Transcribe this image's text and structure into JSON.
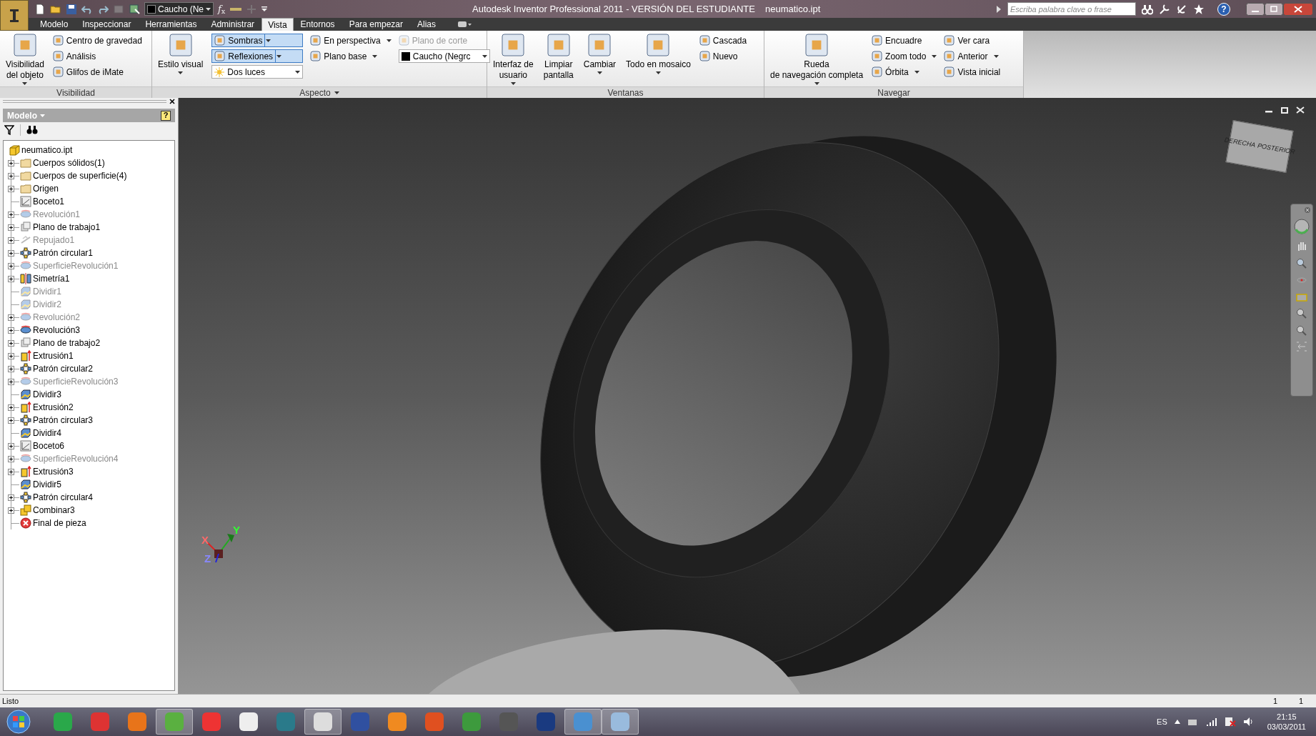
{
  "title_bar": {
    "style_dropdown": "Caucho (Ne",
    "function_button": "*f*$_{x}$",
    "help_button": "?",
    "title": "Autodesk Inventor Professional 2011 - VERSIÓN DEL ESTUDIANTE",
    "document": "neumatico.ipt",
    "search": {
      "placeholder": "Escriba palabra clave o frase"
    }
  },
  "tabs": [
    {
      "label": "Modelo",
      "selected": false
    },
    {
      "label": "Inspeccionar",
      "selected": false
    },
    {
      "label": "Herramientas",
      "selected": false
    },
    {
      "label": "Administrar",
      "selected": false
    },
    {
      "label": "Vista",
      "selected": true
    },
    {
      "label": "Entornos",
      "selected": false
    },
    {
      "label": "Para empezar",
      "selected": false
    },
    {
      "label": "Alias",
      "selected": false
    }
  ],
  "ribbon": [
    {
      "title": "Visibilidad",
      "menu": false,
      "groups": [
        {
          "kind": "large",
          "lines": [
            "Visibilidad",
            "del objeto"
          ],
          "dropdown": true
        },
        {
          "kind": "column",
          "items": [
            {
              "kind": "button",
              "label": "Centro de gravedad",
              "dropdown": false,
              "disabled": false
            },
            {
              "kind": "button",
              "label": "Análisis",
              "dropdown": false,
              "disabled": false
            },
            {
              "kind": "button",
              "label": "Glifos de iMate",
              "dropdown": false,
              "disabled": false
            }
          ]
        }
      ]
    },
    {
      "title": "Aspecto",
      "menu": true,
      "groups": [
        {
          "kind": "large",
          "lines": [
            "Estilo visual"
          ],
          "dropdown": true
        },
        {
          "kind": "column",
          "items": [
            {
              "kind": "toggle",
              "label": "Sombras",
              "on": true
            },
            {
              "kind": "toggle",
              "label": "Reflexiones",
              "on": true
            },
            {
              "kind": "combo",
              "value": "Dos luces",
              "swatch": false
            }
          ]
        },
        {
          "kind": "column",
          "items": [
            {
              "kind": "button",
              "label": "En perspectiva",
              "dropdown": true,
              "disabled": false
            },
            {
              "kind": "button",
              "label": "Plano base",
              "dropdown": true,
              "disabled": false
            }
          ]
        },
        {
          "kind": "column",
          "items": [
            {
              "kind": "button",
              "label": "Plano de corte",
              "dropdown": false,
              "disabled": true
            },
            {
              "kind": "combo",
              "value": "Caucho (Negrc",
              "swatch": true
            }
          ]
        }
      ]
    },
    {
      "title": "Ventanas",
      "menu": false,
      "groups": [
        {
          "kind": "large",
          "lines": [
            "Interfaz de",
            "usuario"
          ],
          "dropdown": true
        },
        {
          "kind": "large",
          "lines": [
            "Limpiar",
            "pantalla"
          ],
          "dropdown": false
        },
        {
          "kind": "large",
          "lines": [
            "Cambiar"
          ],
          "dropdown": true
        },
        {
          "kind": "large",
          "lines": [
            "Todo en mosaico"
          ],
          "dropdown": true
        },
        {
          "kind": "column",
          "items": [
            {
              "kind": "button",
              "label": "Cascada",
              "dropdown": false,
              "disabled": false
            },
            {
              "kind": "button",
              "label": "Nuevo",
              "dropdown": false,
              "disabled": false
            }
          ]
        }
      ]
    },
    {
      "title": "Navegar",
      "menu": false,
      "groups": [
        {
          "kind": "large",
          "lines": [
            "Rueda",
            "de navegación completa"
          ],
          "dropdown": true
        },
        {
          "kind": "column",
          "items": [
            {
              "kind": "button",
              "label": "Encuadre",
              "dropdown": false,
              "disabled": false
            },
            {
              "kind": "button",
              "label": "Zoom todo",
              "dropdown": true,
              "disabled": false
            },
            {
              "kind": "button",
              "label": "Órbita",
              "dropdown": true,
              "disabled": false
            }
          ]
        },
        {
          "kind": "column",
          "items": [
            {
              "kind": "button",
              "label": "Ver cara",
              "dropdown": false,
              "disabled": false
            },
            {
              "kind": "button",
              "label": "Anterior",
              "dropdown": true,
              "disabled": false
            },
            {
              "kind": "button",
              "label": "Vista inicial",
              "dropdown": false,
              "disabled": false
            }
          ]
        }
      ]
    }
  ],
  "browser": {
    "title": "Modelo",
    "help_button": "?",
    "tree": [
      {
        "label": "neumatico.ipt",
        "kind": "part",
        "expandable": false,
        "dimmed": false,
        "children": [
          {
            "label": "Cuerpos sólidos(1)",
            "kind": "folder",
            "expandable": true,
            "dimmed": false
          },
          {
            "label": "Cuerpos de superficie(4)",
            "kind": "folder",
            "expandable": true,
            "dimmed": false
          },
          {
            "label": "Origen",
            "kind": "folder",
            "expandable": true,
            "dimmed": false
          },
          {
            "label": "Boceto1",
            "kind": "sketch",
            "expandable": false,
            "dimmed": false
          },
          {
            "label": "Revolución1",
            "kind": "revolve",
            "expandable": true,
            "dimmed": true
          },
          {
            "label": "Plano de trabajo1",
            "kind": "plane",
            "expandable": true,
            "dimmed": false
          },
          {
            "label": "Repujado1",
            "kind": "emboss",
            "expandable": true,
            "dimmed": true
          },
          {
            "label": "Patrón circular1",
            "kind": "pattern",
            "expandable": true,
            "dimmed": false
          },
          {
            "label": "SuperficieRevolución1",
            "kind": "revolve",
            "expandable": true,
            "dimmed": true
          },
          {
            "label": "Simetría1",
            "kind": "mirror",
            "expandable": true,
            "dimmed": false
          },
          {
            "label": "Dividir1",
            "kind": "split",
            "expandable": false,
            "dimmed": true
          },
          {
            "label": "Dividir2",
            "kind": "split",
            "expandable": false,
            "dimmed": true
          },
          {
            "label": "Revolución2",
            "kind": "revolve",
            "expandable": true,
            "dimmed": true
          },
          {
            "label": "Revolución3",
            "kind": "revolve",
            "expandable": true,
            "dimmed": false
          },
          {
            "label": "Plano de trabajo2",
            "kind": "plane",
            "expandable": true,
            "dimmed": false
          },
          {
            "label": "Extrusión1",
            "kind": "extrude",
            "expandable": true,
            "dimmed": false
          },
          {
            "label": "Patrón circular2",
            "kind": "pattern",
            "expandable": true,
            "dimmed": false
          },
          {
            "label": "SuperficieRevolución3",
            "kind": "revolve",
            "expandable": true,
            "dimmed": true
          },
          {
            "label": "Dividir3",
            "kind": "split",
            "expandable": false,
            "dimmed": false
          },
          {
            "label": "Extrusión2",
            "kind": "extrude",
            "expandable": true,
            "dimmed": false
          },
          {
            "label": "Patrón circular3",
            "kind": "pattern",
            "expandable": true,
            "dimmed": false
          },
          {
            "label": "Dividir4",
            "kind": "split",
            "expandable": false,
            "dimmed": false
          },
          {
            "label": "Boceto6",
            "kind": "sketch",
            "expandable": true,
            "dimmed": false
          },
          {
            "label": "SuperficieRevolución4",
            "kind": "revolve",
            "expandable": true,
            "dimmed": true
          },
          {
            "label": "Extrusión3",
            "kind": "extrude",
            "expandable": true,
            "dimmed": false
          },
          {
            "label": "Dividir5",
            "kind": "split",
            "expandable": false,
            "dimmed": false
          },
          {
            "label": "Patrón circular4",
            "kind": "pattern",
            "expandable": true,
            "dimmed": false
          },
          {
            "label": "Combinar3",
            "kind": "combine",
            "expandable": true,
            "dimmed": false
          },
          {
            "label": "Final de pieza",
            "kind": "end",
            "expandable": false,
            "dimmed": false
          }
        ]
      }
    ]
  },
  "viewport": {
    "view_cube": [
      "DERECHA",
      "POSTERIOR"
    ],
    "axes": [
      "X",
      "Y",
      "Z"
    ]
  },
  "status_bar": {
    "message": "Listo",
    "fields": [
      "1",
      "1"
    ]
  },
  "taskbar": {
    "language": "ES",
    "time": "21:15",
    "date": "03/03/2011"
  }
}
